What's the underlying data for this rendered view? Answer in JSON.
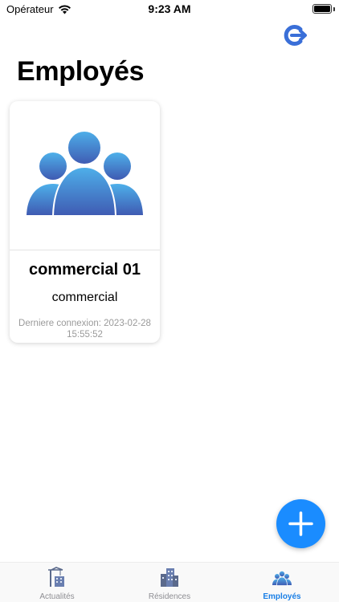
{
  "status_bar": {
    "carrier": "Opérateur",
    "time": "9:23 AM"
  },
  "header": {
    "title": "Employés",
    "logout_icon": "logout-icon"
  },
  "employees": [
    {
      "name": "commercial 01",
      "role": "commercial",
      "last_login": "Derniere connexion: 2023-02-28 15:55:52",
      "avatar_icon": "group-users-icon"
    }
  ],
  "fab": {
    "icon": "plus-icon",
    "color": "#1a8cff"
  },
  "tab_bar": {
    "tabs": [
      {
        "label": "Actualités",
        "icon": "crane-building-icon",
        "active": false
      },
      {
        "label": "Résidences",
        "icon": "buildings-icon",
        "active": false
      },
      {
        "label": "Employés",
        "icon": "people-icon",
        "active": true
      }
    ],
    "active_color": "#1a7fe6",
    "inactive_color": "#8e8e93"
  }
}
